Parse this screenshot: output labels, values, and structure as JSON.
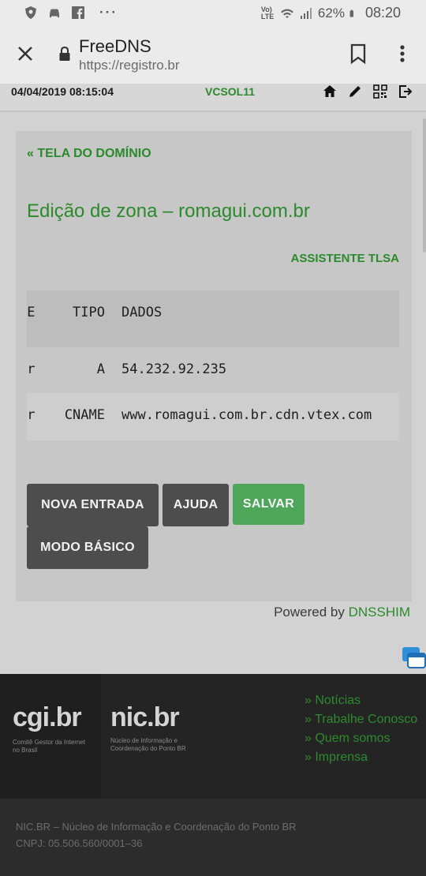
{
  "status_bar": {
    "percent": "62%",
    "time": "08:20",
    "network": "Vo) LTE",
    "dots": "···",
    "icons": [
      "shield-icon",
      "car-icon",
      "facebook-icon",
      "wifi-icon",
      "signal-icon",
      "battery-icon"
    ]
  },
  "browser": {
    "title": "FreeDNS",
    "url": "https://registro.br",
    "icons": [
      "close-icon",
      "lock-icon",
      "bookmark-icon",
      "more-vert-icon"
    ]
  },
  "topbar": {
    "datetime": "04/04/2019 08:15:04",
    "user": "VCSOL11",
    "icons": [
      "home-icon",
      "pencil-icon",
      "qrcode-icon",
      "logout-icon"
    ]
  },
  "page": {
    "back_link": "« TELA DO DOMÍNIO",
    "title": "Edição de zona – romagui.com.br",
    "tlsa_link": "ASSISTENTE TLSA",
    "table": {
      "headers": {
        "name": "ME",
        "type": "TIPO",
        "data": "DADOS"
      },
      "rows": [
        {
          "name": "or",
          "type": "A",
          "data": "54.232.92.235"
        },
        {
          "name": "or",
          "type": "CNAME",
          "data": "www.romagui.com.br.cdn.vtex.com"
        }
      ]
    },
    "buttons": {
      "nova_entrada": "NOVA ENTRADA",
      "ajuda": "AJUDA",
      "salvar": "SALVAR",
      "modo_basico": "MODO BÁSICO"
    },
    "powered_by": "Powered by",
    "powered_brand": "DNSSHIM"
  },
  "footer": {
    "cgi_logo": "cgi.br",
    "cgi_sub": "Comitê Gestor da Internet no Brasil",
    "nic_logo": "nic.br",
    "nic_sub": "Núcleo de Informação e Coordenação do Ponto BR",
    "links": [
      "» Notícias",
      "» Trabalhe Conosco",
      "» Quem somos",
      "» Imprensa"
    ],
    "org": "NIC.BR – Núcleo de Informação e Coordenação do Ponto BR",
    "cnpj": "CNPJ: 05.506.560/0001–36"
  },
  "colors": {
    "green": "#2b8a2b",
    "button_green": "#4ea65b",
    "button_dark": "#4d4d4d"
  }
}
